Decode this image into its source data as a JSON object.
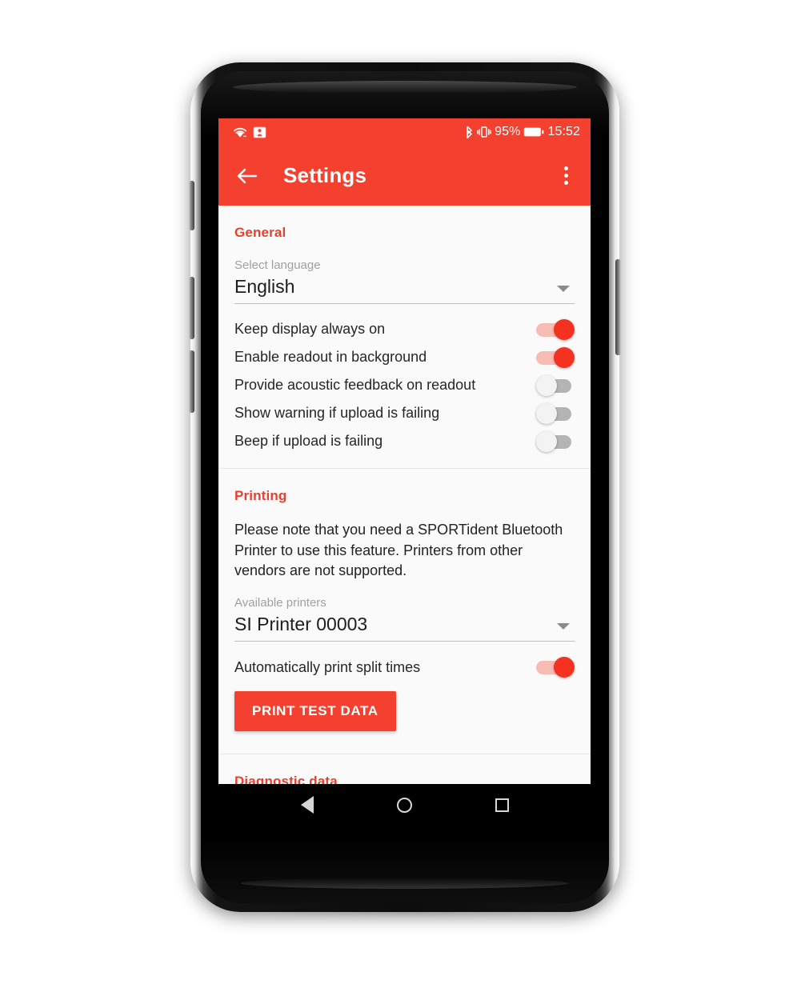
{
  "theme": {
    "accent": "#F4402F",
    "accent_text": "#E8402F",
    "screen_bg": "#fafafa",
    "toggle_on_track": "#f7bdb5",
    "toggle_on_thumb": "#F4321F",
    "toggle_off_track": "#b4b4b4",
    "toggle_off_thumb": "#f3f3f3"
  },
  "status_bar": {
    "icons_left": [
      "wifi-icon",
      "screen-cast-icon"
    ],
    "icons_right": [
      "bluetooth-icon",
      "vibrate-icon",
      "battery-icon"
    ],
    "battery_percent": "95%",
    "clock": "15:52"
  },
  "app_bar": {
    "back_icon": "back-arrow-icon",
    "title": "Settings",
    "overflow_icon": "overflow-menu-icon"
  },
  "sections": {
    "general": {
      "title": "General",
      "language_label": "Select language",
      "language_value": "English",
      "language_caret": "chevron-down-icon",
      "toggles": [
        {
          "label": "Keep display always on",
          "state": "on"
        },
        {
          "label": "Enable readout in background",
          "state": "on"
        },
        {
          "label": "Provide acoustic feedback on readout",
          "state": "off"
        },
        {
          "label": "Show warning if upload is failing",
          "state": "off"
        },
        {
          "label": "Beep if upload is failing",
          "state": "off"
        }
      ]
    },
    "printing": {
      "title": "Printing",
      "note": "Please note that you need a SPORTident Bluetooth Printer to use this feature. Printers from other vendors are not supported.",
      "printers_label": "Available printers",
      "printers_value": "SI Printer 00003",
      "printers_caret": "chevron-down-icon",
      "auto_print_label": "Automatically print split times",
      "auto_print_state": "on",
      "print_test_button": "PRINT TEST DATA"
    },
    "diagnostic": {
      "title": "Diagnostic data"
    }
  },
  "nav_bar": {
    "back": "nav-back-icon",
    "home": "nav-home-icon",
    "recents": "nav-recents-icon"
  }
}
